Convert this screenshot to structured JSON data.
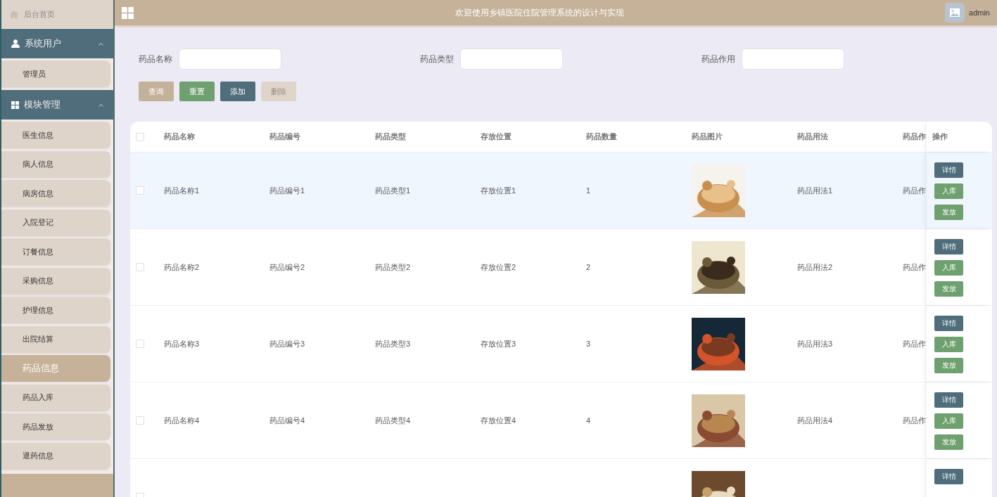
{
  "top_bar": {
    "title": "欢迎使用乡镇医院住院管理系统的设计与实现",
    "user": "admin"
  },
  "sidebar": {
    "home": "后台首页",
    "groups": [
      {
        "title": "系统用户",
        "expanded": true,
        "items": [
          {
            "label": "管理员",
            "selected": false
          }
        ]
      },
      {
        "title": "模块管理",
        "expanded": true,
        "items": [
          {
            "label": "医生信息",
            "selected": false
          },
          {
            "label": "病人信息",
            "selected": false
          },
          {
            "label": "病房信息",
            "selected": false
          },
          {
            "label": "入院登记",
            "selected": false
          },
          {
            "label": "订餐信息",
            "selected": false
          },
          {
            "label": "采购信息",
            "selected": false
          },
          {
            "label": "护理信息",
            "selected": false
          },
          {
            "label": "出院结算",
            "selected": false
          },
          {
            "label": "药品信息",
            "selected": true
          },
          {
            "label": "药品入库",
            "selected": false
          },
          {
            "label": "药品发放",
            "selected": false
          },
          {
            "label": "退药信息",
            "selected": false
          }
        ]
      }
    ]
  },
  "search": {
    "fields": [
      {
        "label": "药品名称"
      },
      {
        "label": "药品类型"
      },
      {
        "label": "药品作用"
      }
    ],
    "buttons": [
      {
        "label": "查询",
        "kind": "query",
        "disabled": false
      },
      {
        "label": "重置",
        "kind": "reset",
        "disabled": false
      },
      {
        "label": "添加",
        "kind": "add",
        "disabled": false
      },
      {
        "label": "删除",
        "kind": "delete",
        "disabled": true
      }
    ]
  },
  "table": {
    "columns": [
      "药品名称",
      "药品编号",
      "药品类型",
      "存放位置",
      "药品数量",
      "药品图片",
      "药品用法",
      "药品作"
    ],
    "action_column": "操作",
    "all_checked": false,
    "rows": [
      {
        "highlighted": true,
        "checked": false,
        "cells": [
          "药品名称1",
          "药品编号1",
          "药品类型1",
          "存放位置1",
          "1",
          null,
          "药品用法1",
          "药品作"
        ],
        "image": {
          "kind": "picture"
        },
        "actions": [
          {
            "label": "详情",
            "kind": "detail"
          },
          {
            "label": "入库",
            "kind": "stock"
          },
          {
            "label": "发放",
            "kind": "stock"
          }
        ]
      },
      {
        "highlighted": false,
        "checked": false,
        "cells": [
          "药品名称2",
          "药品编号2",
          "药品类型2",
          "存放位置2",
          "2",
          null,
          "药品用法2",
          "药品作"
        ],
        "image": {
          "kind": "picture"
        },
        "actions": [
          {
            "label": "详情",
            "kind": "detail"
          },
          {
            "label": "入库",
            "kind": "stock"
          },
          {
            "label": "发放",
            "kind": "stock"
          }
        ]
      },
      {
        "highlighted": false,
        "checked": false,
        "cells": [
          "药品名称3",
          "药品编号3",
          "药品类型3",
          "存放位置3",
          "3",
          null,
          "药品用法3",
          "药品作"
        ],
        "image": {
          "kind": "picture"
        },
        "actions": [
          {
            "label": "详情",
            "kind": "detail"
          },
          {
            "label": "入库",
            "kind": "stock"
          },
          {
            "label": "发放",
            "kind": "stock"
          }
        ]
      },
      {
        "highlighted": false,
        "checked": false,
        "cells": [
          "药品名称4",
          "药品编号4",
          "药品类型4",
          "存放位置4",
          "4",
          null,
          "药品用法4",
          "药品作"
        ],
        "image": {
          "kind": "picture"
        },
        "actions": [
          {
            "label": "详情",
            "kind": "detail"
          },
          {
            "label": "入库",
            "kind": "stock"
          },
          {
            "label": "发放",
            "kind": "stock"
          }
        ]
      },
      {
        "highlighted": false,
        "checked": false,
        "cells": [],
        "image": {
          "kind": "picture"
        },
        "actions": [
          {
            "label": "详情",
            "kind": "detail"
          }
        ]
      }
    ]
  }
}
